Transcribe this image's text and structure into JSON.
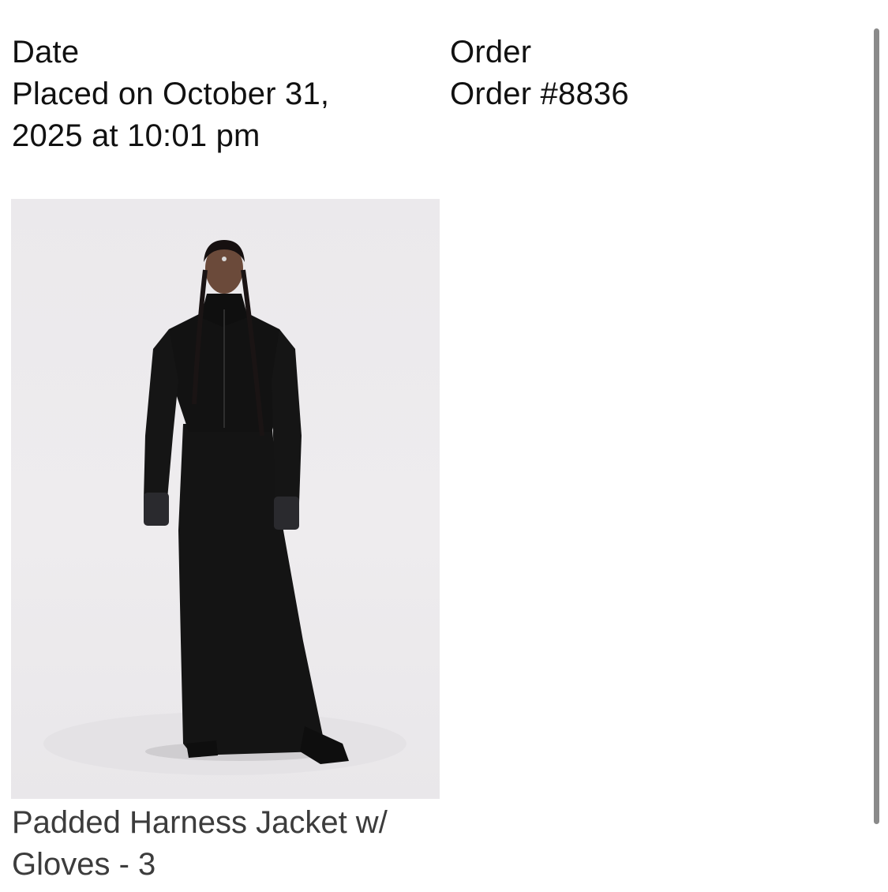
{
  "order_summary": {
    "date_label": "Date",
    "date_value": "Placed on October 31, 2025 at 10:01 pm",
    "order_label": "Order",
    "order_value": "Order #8836"
  },
  "product": {
    "name": "Padded Harness Jacket w/ Gloves - 3",
    "image_alt": "Model wearing black padded harness jacket with gloves and long black skirt"
  },
  "colors": {
    "background": "#ffffff",
    "text": "#111111",
    "product_text": "#3c3c3c",
    "scrollbar": "#8a8a8a",
    "photo_backdrop": "#ecebed"
  }
}
